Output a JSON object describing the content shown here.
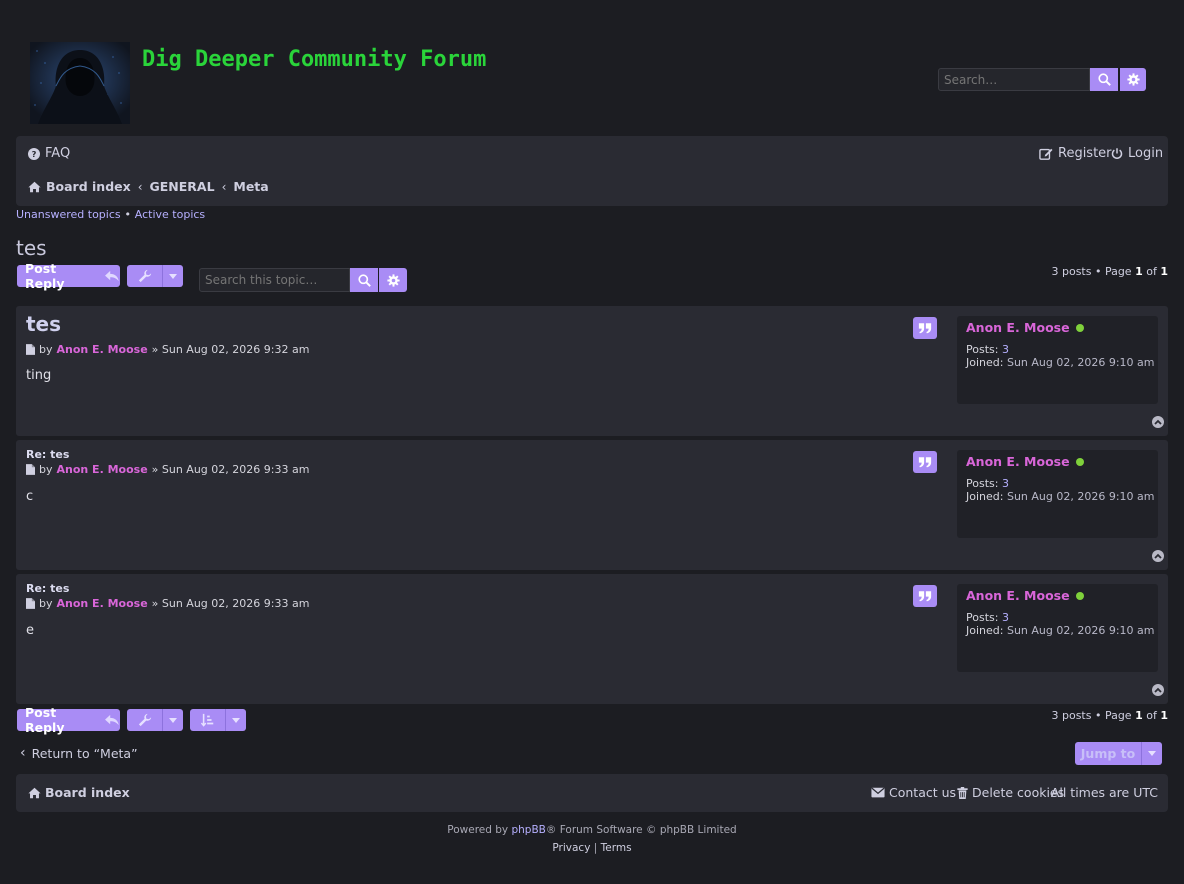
{
  "site": {
    "title": "Dig Deeper Community Forum"
  },
  "header_search": {
    "placeholder": "Search…"
  },
  "nav": {
    "faq": "FAQ",
    "register": "Register",
    "login": "Login",
    "breadcrumbs": [
      "Board index",
      "GENERAL",
      "Meta"
    ]
  },
  "quick_links": {
    "unanswered": "Unanswered topics",
    "separator": "•",
    "active": "Active topics"
  },
  "topic": {
    "title": "tes",
    "post_reply": "Post Reply",
    "search_placeholder": "Search this topic…",
    "pagination": {
      "count": "3 posts • Page ",
      "page": "1",
      "of": " of ",
      "total": "1"
    }
  },
  "posts": [
    {
      "title": "tes",
      "by": "by",
      "author": "Anon E. Moose",
      "date": "» Sun Aug 02, 2026 9:32 am",
      "body": "ting",
      "profile": {
        "name": "Anon E. Moose",
        "posts_label": "Posts:",
        "posts": "3",
        "joined_label": "Joined:",
        "joined": "Sun Aug 02, 2026 9:10 am"
      }
    },
    {
      "title": "Re: tes",
      "by": "by",
      "author": "Anon E. Moose",
      "date": "» Sun Aug 02, 2026 9:33 am",
      "body": "c",
      "profile": {
        "name": "Anon E. Moose",
        "posts_label": "Posts:",
        "posts": "3",
        "joined_label": "Joined:",
        "joined": "Sun Aug 02, 2026 9:10 am"
      }
    },
    {
      "title": "Re: tes",
      "by": "by",
      "author": "Anon E. Moose",
      "date": "» Sun Aug 02, 2026 9:33 am",
      "body": "e",
      "profile": {
        "name": "Anon E. Moose",
        "posts_label": "Posts:",
        "posts": "3",
        "joined_label": "Joined:",
        "joined": "Sun Aug 02, 2026 9:10 am"
      }
    }
  ],
  "bottom": {
    "return_link": "Return to “Meta”",
    "jump_to": "Jump to"
  },
  "footer": {
    "board_index": "Board index",
    "contact": "Contact us",
    "delete_cookies": "Delete cookies",
    "timezone": "All times are UTC",
    "powered_prefix": "Powered by ",
    "phpbb": "phpBB",
    "powered_suffix": "® Forum Software © phpBB Limited",
    "privacy": "Privacy",
    "divider": "|",
    "terms": "Terms"
  },
  "colors": {
    "background": "#1c1d22",
    "panel": "#2a2b33",
    "accent": "#a98cf5",
    "title_green": "#2ad43a",
    "author": "#d966d9",
    "online": "#7fd13b"
  },
  "icons": [
    "question-circle-icon",
    "edit-icon",
    "power-icon",
    "home-icon",
    "reply-icon",
    "wrench-icon",
    "search-icon",
    "gear-icon",
    "quote-icon",
    "file-icon",
    "circle-up-icon",
    "sort-icon",
    "chevron-left-icon",
    "envelope-icon",
    "trash-icon"
  ]
}
